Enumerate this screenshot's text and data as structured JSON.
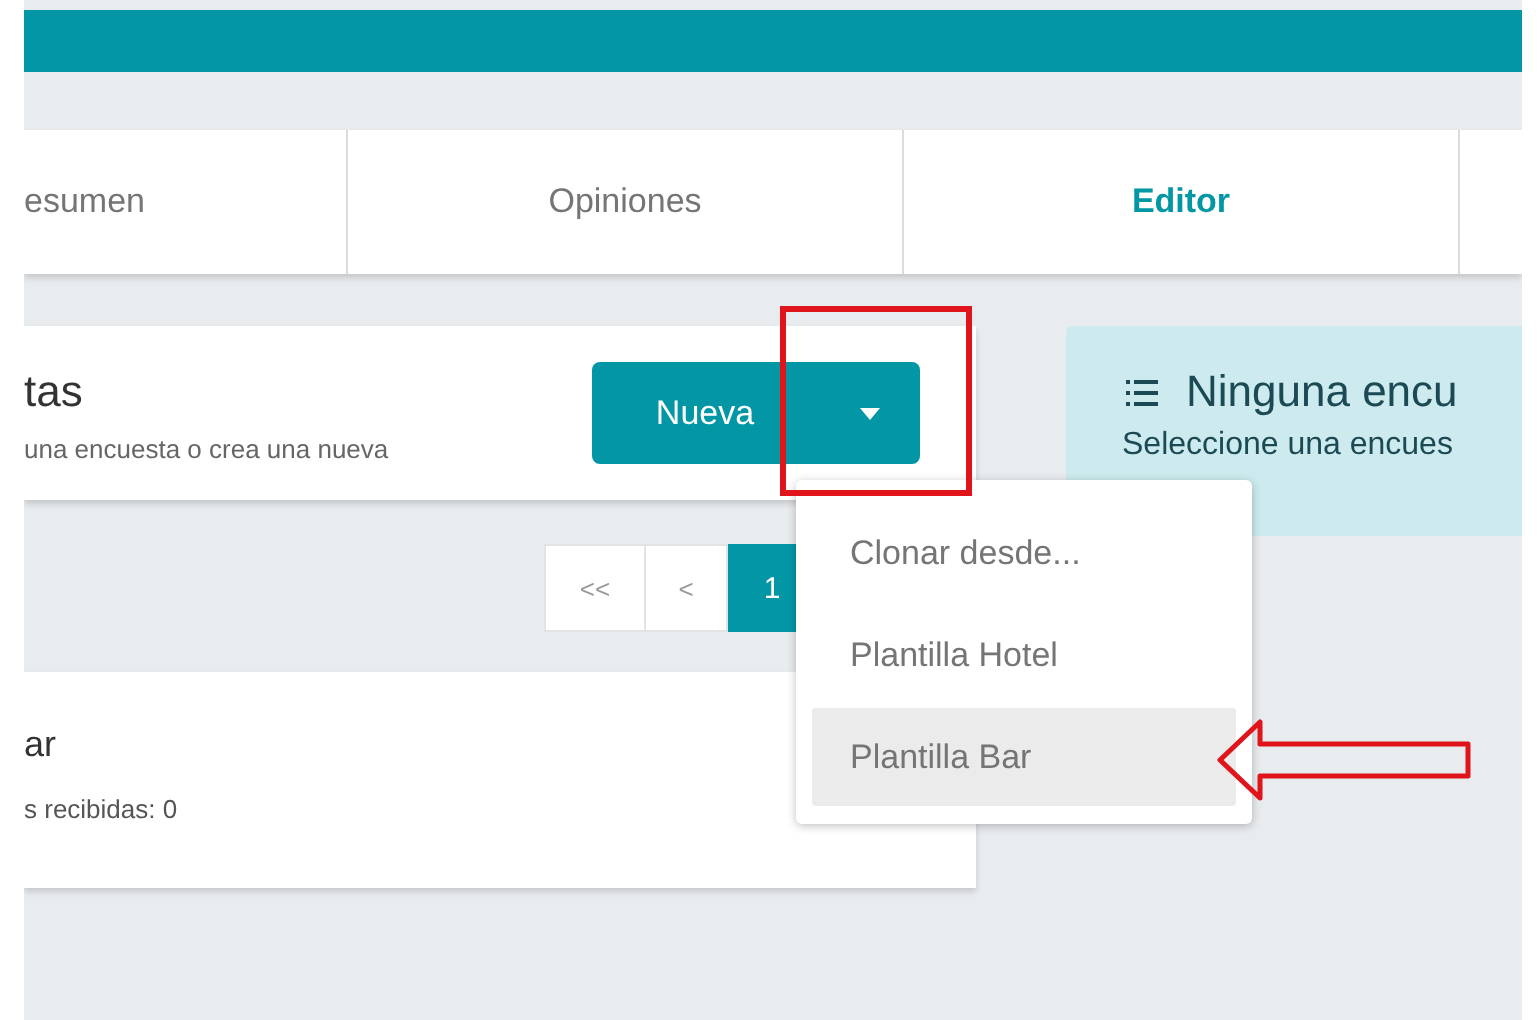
{
  "tabs": [
    {
      "label": "esumen",
      "selected": false
    },
    {
      "label": "Opiniones",
      "selected": false
    },
    {
      "label": "Editor",
      "selected": true
    }
  ],
  "surveys_header": {
    "title": "tas",
    "subtitle": "una encuesta o crea una nueva",
    "new_button": "Nueva"
  },
  "pagination": [
    {
      "label": "<<",
      "selected": false
    },
    {
      "label": "<",
      "selected": false
    },
    {
      "label": "1",
      "selected": true
    }
  ],
  "survey_card": {
    "title": "ar",
    "meta": "s recibidas: 0"
  },
  "info_panel": {
    "title": "Ninguna encu",
    "text": "Seleccione una encues"
  },
  "dropdown": [
    {
      "label": "Clonar desde...",
      "selected": false
    },
    {
      "label": "Plantilla Hotel",
      "selected": false
    },
    {
      "label": "Plantilla Bar",
      "selected": true
    }
  ]
}
